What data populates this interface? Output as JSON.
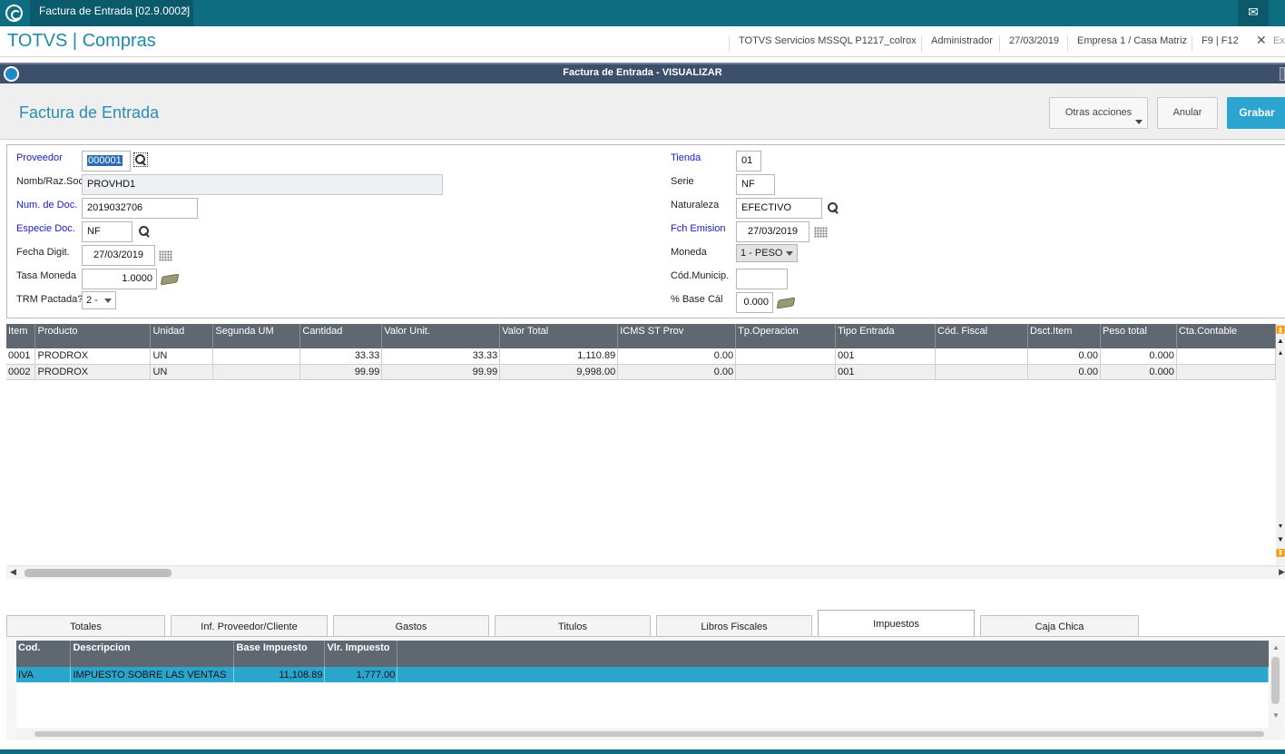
{
  "topbar": {
    "tab_title": "Factura de Entrada [02.9.0002]",
    "tab_close": "×",
    "mail_icon": "mail-icon"
  },
  "header": {
    "brand": "TOTVS | Compras",
    "server": "TOTVS Servicios MSSQL P1217_colrox",
    "user": "Administrador",
    "date": "27/03/2019",
    "company": "Empresa 1 / Casa Matriz",
    "keys": "F9 | F12",
    "exit_label": "Ex"
  },
  "window": {
    "title": "Factura de Entrada - VISUALIZAR"
  },
  "page": {
    "title": "Factura de Entrada",
    "other_actions": "Otras acciones",
    "cancel": "Anular",
    "save": "Grabar"
  },
  "form": {
    "proveedor_label": "Proveedor",
    "proveedor_value": "000001",
    "nomb_label": "Nomb/Raz.Soc",
    "nomb_value": "PROVHD1",
    "numdoc_label": "Num. de Doc.",
    "numdoc_value": "2019032706",
    "especie_label": "Especie Doc.",
    "especie_value": "NF",
    "fechadigit_label": "Fecha Digit.",
    "fechadigit_value": "27/03/2019",
    "tasa_label": "Tasa Moneda",
    "tasa_value": "1.0000",
    "trm_label": "TRM Pactada?",
    "trm_value": "2 -",
    "tienda_label": "Tienda",
    "tienda_value": "01",
    "serie_label": "Serie",
    "serie_value": "NF",
    "naturaleza_label": "Naturaleza",
    "naturaleza_value": "EFECTIVO",
    "fchemision_label": "Fch Emision",
    "fchemision_value": "27/03/2019",
    "moneda_label": "Moneda",
    "moneda_value": "1 - PESO",
    "codmunicip_label": "Cód.Municip.",
    "codmunicip_value": "",
    "basecal_label": "% Base Cál",
    "basecal_value": "0.000"
  },
  "items_grid": {
    "columns": [
      "Item",
      "Producto",
      "Unidad",
      "Segunda UM",
      "Cantidad",
      "Valor Unit.",
      "Valor Total",
      "ICMS ST Prov",
      "Tp.Operacion",
      "Tipo Entrada",
      "Cód. Fiscal",
      "Dsct.Item",
      "Peso total",
      "Cta.Contable"
    ],
    "rows": [
      [
        "0001",
        "PRODROX",
        "UN",
        "",
        "33.33",
        "33.33",
        "1,110.89",
        "0.00",
        "",
        "001",
        "",
        "0.00",
        "0.000",
        ""
      ],
      [
        "0002",
        "PRODROX",
        "UN",
        "",
        "99.99",
        "99.99",
        "9,998.00",
        "0.00",
        "",
        "001",
        "",
        "0.00",
        "0.000",
        ""
      ]
    ]
  },
  "bottom_tabs": [
    "Totales",
    "Inf. Proveedor/Cliente",
    "Gastos",
    "Titulos",
    "Libros Fiscales",
    "Impuestos",
    "Caja Chica"
  ],
  "active_tab": "Impuestos",
  "tax_grid": {
    "columns": [
      "Cod.",
      "Descripcion",
      "Base Impuesto",
      "Vlr. Impuesto"
    ],
    "rows": [
      [
        "IVA",
        "IMPUESTO SOBRE LAS VENTAS",
        "11,108.89",
        "1,777.00"
      ]
    ]
  },
  "colors": {
    "topbar": "#0f6d82",
    "accent": "#2ba4cf",
    "grid_header": "#5f6770",
    "selected_row": "#2aa6cc"
  }
}
